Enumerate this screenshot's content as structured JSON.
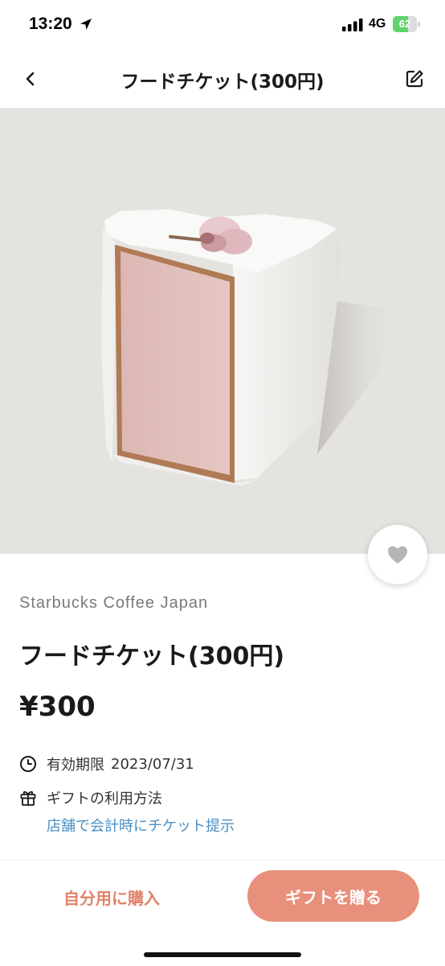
{
  "status_bar": {
    "time": "13:20",
    "network": "4G",
    "battery_percent": 62,
    "battery_label": "62",
    "location_icon": "location-arrow-icon",
    "signal_icon": "signal-bars-icon"
  },
  "nav": {
    "title": "フードチケット(300円)",
    "back_icon": "chevron-left-icon",
    "edit_icon": "edit-icon"
  },
  "hero": {
    "image": "sakura chiffon cake slice",
    "favorite_icon": "heart-icon"
  },
  "product": {
    "brand": "Starbucks Coffee Japan",
    "title": "フードチケット(300円)",
    "price": "¥300"
  },
  "info": {
    "expiry_label": "有効期限",
    "expiry_date": "2023/07/31",
    "expiry_icon": "clock-icon",
    "usage_label": "ギフトの利用方法",
    "usage_icon": "gift-icon",
    "usage_method": "店舗で会計時にチケット提示"
  },
  "actions": {
    "buy_self_label": "自分用に購入",
    "gift_label": "ギフトを贈る"
  },
  "colors": {
    "accent": "#e8907b",
    "accent_text": "#e0836a",
    "link": "#4a8fc4",
    "hero_bg": "#e5e3e0"
  }
}
